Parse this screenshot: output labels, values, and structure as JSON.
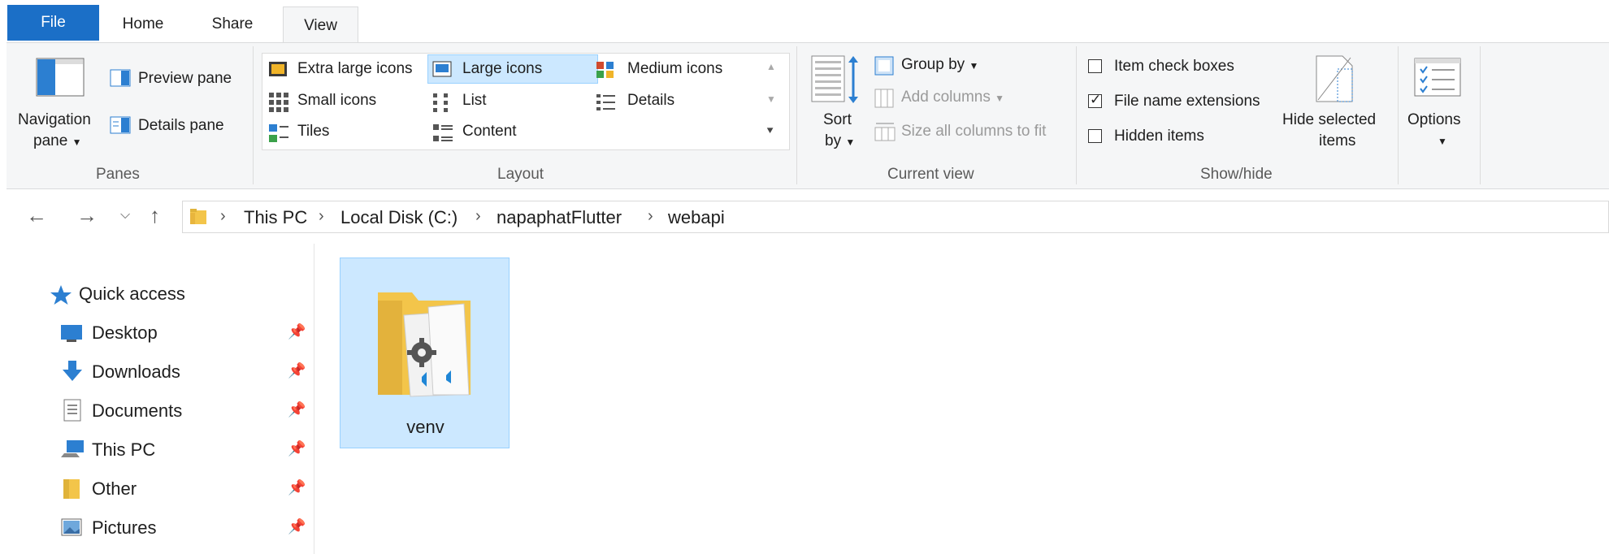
{
  "tabs": {
    "file": "File",
    "home": "Home",
    "share": "Share",
    "view": "View"
  },
  "panes": {
    "navigation_pane": [
      "Navigation",
      "pane"
    ],
    "preview_pane": "Preview pane",
    "details_pane": "Details pane",
    "group_label": "Panes"
  },
  "layout": {
    "options": {
      "extra_large": "Extra large icons",
      "large": "Large icons",
      "medium": "Medium icons",
      "small": "Small icons",
      "list": "List",
      "details": "Details",
      "tiles": "Tiles",
      "content": "Content"
    },
    "selected": "Large icons",
    "group_label": "Layout"
  },
  "current_view": {
    "sort_by": [
      "Sort",
      "by"
    ],
    "group_by": "Group by",
    "add_columns": "Add columns",
    "size_columns": "Size all columns to fit",
    "group_label": "Current view"
  },
  "show_hide": {
    "item_check_boxes": {
      "label": "Item check boxes",
      "checked": false
    },
    "file_name_extensions": {
      "label": "File name extensions",
      "checked": true
    },
    "hidden_items": {
      "label": "Hidden items",
      "checked": false
    },
    "hide_selected": [
      "Hide selected",
      "items"
    ],
    "group_label": "Show/hide"
  },
  "options": {
    "label": "Options"
  },
  "address": {
    "crumbs": [
      "This PC",
      "Local Disk (C:)",
      "napaphatFlutter",
      "webapi"
    ]
  },
  "sidebar": {
    "quick_access": "Quick access",
    "items": [
      "Desktop",
      "Downloads",
      "Documents",
      "This PC",
      "Other",
      "Pictures"
    ]
  },
  "content": {
    "items": [
      {
        "name": "venv",
        "icon": "vscode-folder-icon",
        "selected": true
      }
    ]
  },
  "colors": {
    "accent": "#1b6fc7",
    "selection": "#cce8ff",
    "selection_border": "#99d1ff"
  }
}
